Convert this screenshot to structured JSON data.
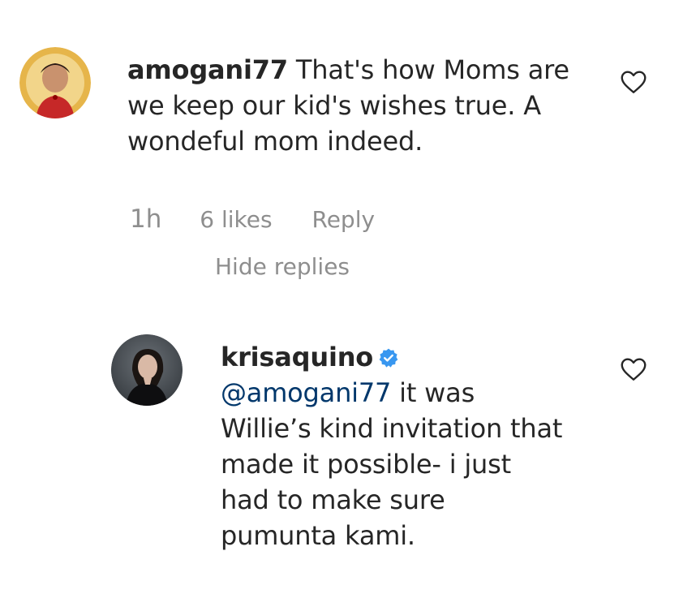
{
  "comment": {
    "username": "amogani77",
    "text": "That's how Moms are we keep our kid's wishes true. A wondeful mom indeed.",
    "line1_rest": "That's how Moms are",
    "line2": "we keep our kid's wishes true. A",
    "line3": "wondeful mom indeed.",
    "time": "1h",
    "likes": "6 likes",
    "reply_label": "Reply",
    "hide_replies_label": "Hide replies"
  },
  "reply": {
    "username": "krisaquino",
    "verified": true,
    "mention": "@amogani77",
    "line1_rest": "it was",
    "line2": "Willie’s kind invitation that",
    "line3": "made it possible- i just",
    "line4": "had to make sure",
    "line5": "pumunta kami."
  },
  "icons": {
    "like": "heart-outline-icon",
    "verified": "verified-badge-icon"
  },
  "colors": {
    "text": "#262626",
    "muted": "#8e8e8e",
    "mention": "#00376b",
    "verified": "#3897f0"
  }
}
